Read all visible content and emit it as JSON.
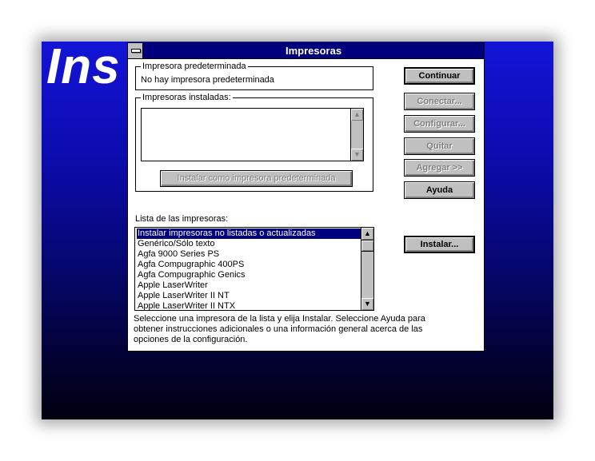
{
  "background_title": "Ins",
  "dialog": {
    "title": "Impresoras",
    "default_printer": {
      "legend": "Impresora predeterminada",
      "value": "No hay impresora predeterminada"
    },
    "installed": {
      "legend": "Impresoras instaladas:",
      "items": [],
      "set_default_button": "Instalar como impresora predeterminada"
    },
    "buttons": {
      "continuar": "Continuar",
      "conectar": "Conectar...",
      "configurar": "Configurar...",
      "quitar": "Quitar",
      "agregar": "Agregar >>",
      "ayuda": "Ayuda",
      "instalar": "Instalar..."
    },
    "printer_list": {
      "label": "Lista de las impresoras:",
      "items": [
        "Instalar impresoras no listadas o actualizadas",
        "Genérico/Sólo texto",
        "Agfa 9000 Series PS",
        "Agfa Compugraphic 400PS",
        "Agfa Compugraphic Genics",
        "Apple LaserWriter",
        "Apple LaserWriter II NT",
        "Apple LaserWriter II NTX"
      ],
      "selected_index": 0
    },
    "help_text": [
      "Seleccione una impresora de la lista y elija Instalar. Seleccione Ayuda para",
      "obtener instrucciones adicionales o una información general acerca de las",
      "opciones de la configuración."
    ]
  },
  "colors": {
    "title_bar": "#00007f",
    "button_face": "#c0c0c0",
    "selection": "#00007f"
  }
}
